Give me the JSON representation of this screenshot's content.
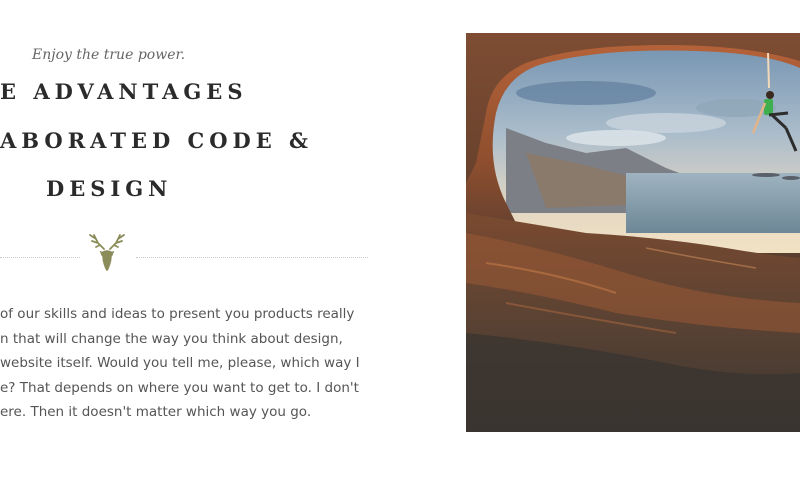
{
  "hero": {
    "tagline": "Enjoy the true power.",
    "heading_lines": [
      "E ADVANTAGES",
      "ABORATED CODE &",
      "DESIGN"
    ],
    "divider_icon": "deer-head-icon",
    "body_lines": [
      " of our skills and ideas to present you products really",
      "n that will change the way you think about design,",
      "website itself. Would you tell me, please, which way I",
      "e? That depends on where you want to get to. I don't",
      "ere. Then it doesn't matter which way you go."
    ]
  },
  "media": {
    "image_subject": "rock-climber-in-sea-cave-photo"
  },
  "colors": {
    "heading": "#2b2b2b",
    "text": "#555555",
    "accent_icon": "#8a8c5a",
    "divider": "#c9c9c9"
  }
}
